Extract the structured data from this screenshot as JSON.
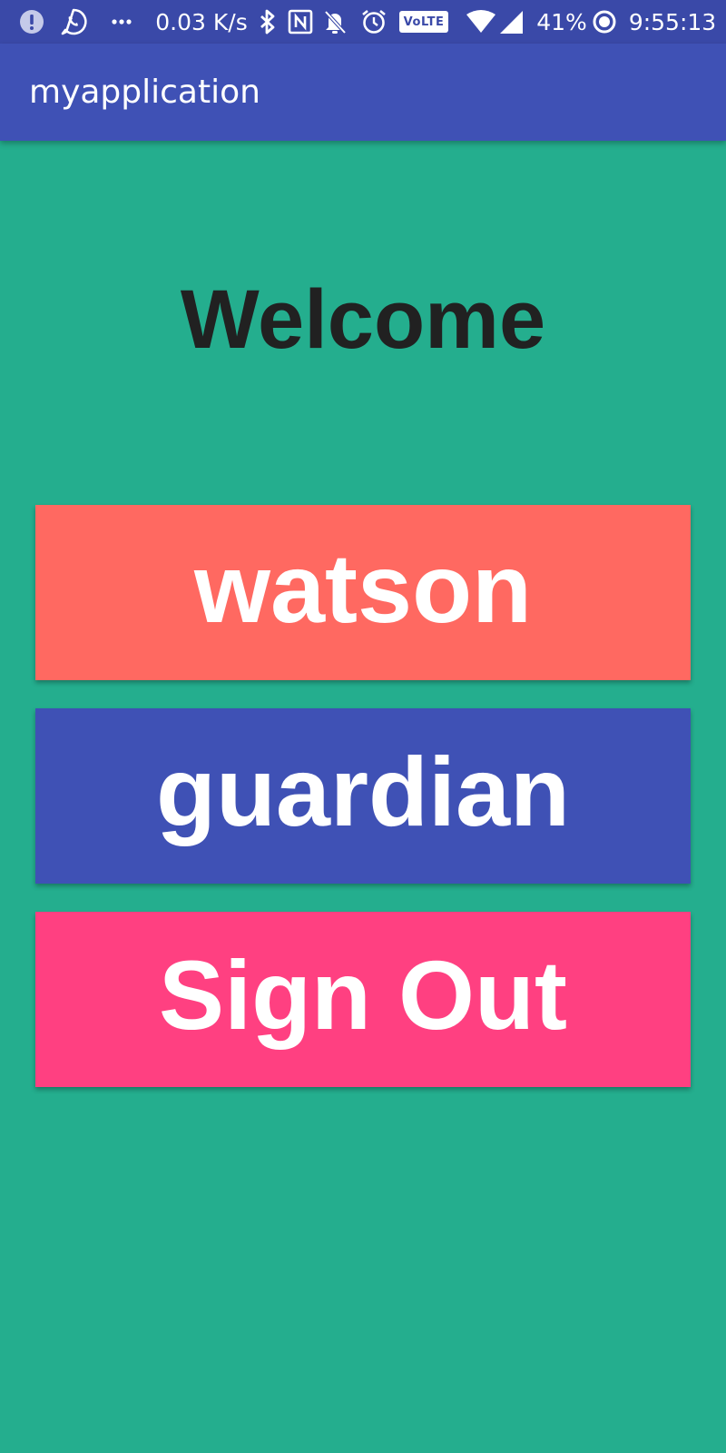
{
  "status_bar": {
    "network_speed": "0.03 K/s",
    "volte_label": "VoLTE",
    "battery_percent": "41%",
    "time": "9:55:13",
    "icons": [
      "alert-icon",
      "whatsapp-icon",
      "more-dots-icon",
      "bluetooth-icon",
      "nfc-icon",
      "notifications-off-icon",
      "alarm-icon",
      "volte-icon",
      "wifi-icon",
      "signal-icon",
      "battery-icon"
    ]
  },
  "app_bar": {
    "title": "myapplication"
  },
  "main": {
    "welcome": "Welcome",
    "buttons": {
      "watson": "watson",
      "guardian": "guardian",
      "sign_out": "Sign Out"
    }
  },
  "colors": {
    "background": "#24ae8e",
    "status_bar": "#3a49a8",
    "app_bar": "#3f51b5",
    "watson_button": "#ff6961",
    "guardian_button": "#3f51b5",
    "sign_out_button": "#ff4081",
    "welcome_text": "#212121"
  }
}
